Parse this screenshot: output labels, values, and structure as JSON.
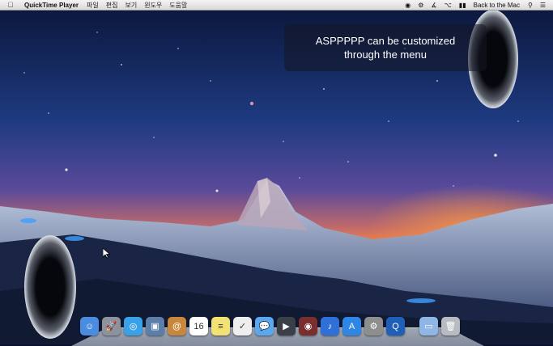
{
  "menubar": {
    "apple_icon": "apple-icon",
    "app_name": "QuickTime Player",
    "menus": [
      "파일",
      "편집",
      "보기",
      "윈도우",
      "도움말"
    ],
    "status_icons": [
      "record-icon",
      "settings-icon",
      "bluetooth-icon",
      "wifi-icon",
      "battery-icon"
    ],
    "clock_text": "Back to the Mac",
    "spotlight_icon": "spotlight-icon",
    "notification_icon": "list-icon"
  },
  "toast": {
    "message": "ASPPPPP can be customized\nthrough the menu"
  },
  "dock": {
    "apps": [
      {
        "name": "finder",
        "color": "#4a8de0",
        "glyph": "☺"
      },
      {
        "name": "launchpad",
        "color": "#8d939c",
        "glyph": "🚀"
      },
      {
        "name": "safari",
        "color": "#3aa0e8",
        "glyph": "◎"
      },
      {
        "name": "preview-photos",
        "color": "#5b7fa8",
        "glyph": "▣"
      },
      {
        "name": "contacts",
        "color": "#c9873c",
        "glyph": "@"
      },
      {
        "name": "calendar",
        "color": "#ffffff",
        "glyph": "16"
      },
      {
        "name": "notes",
        "color": "#f2e173",
        "glyph": "≡"
      },
      {
        "name": "reminders",
        "color": "#eeeeee",
        "glyph": "✓"
      },
      {
        "name": "messages",
        "color": "#5aa9f0",
        "glyph": "💬"
      },
      {
        "name": "facetime",
        "color": "#3a3f48",
        "glyph": "▶"
      },
      {
        "name": "photo-booth",
        "color": "#7a2f2f",
        "glyph": "◉"
      },
      {
        "name": "itunes",
        "color": "#2f6fd8",
        "glyph": "♪"
      },
      {
        "name": "app-store",
        "color": "#2f86e6",
        "glyph": "A"
      },
      {
        "name": "system-preferences",
        "color": "#8e8e8e",
        "glyph": "⚙"
      },
      {
        "name": "quicktime",
        "color": "#1f5fb8",
        "glyph": "Q"
      }
    ],
    "stacks": [
      {
        "name": "downloads-folder",
        "color": "#8fb7e6",
        "glyph": "▭"
      },
      {
        "name": "trash",
        "color": "#b8bcc2",
        "glyph": "🗑"
      }
    ]
  }
}
